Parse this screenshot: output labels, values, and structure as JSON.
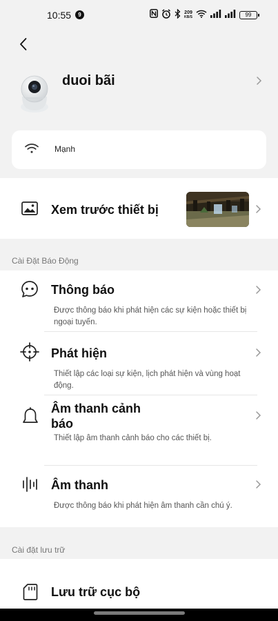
{
  "status_bar": {
    "time": "10:55",
    "notification_count": "9",
    "net_speed_value": "209",
    "net_speed_unit": "KB/S",
    "battery": "99"
  },
  "device": {
    "name": "duoi bãi"
  },
  "signal": {
    "label": "Mạnh"
  },
  "preview": {
    "title": "Xem trước thiết bị"
  },
  "alarm_section": {
    "header": "Cài Đặt Báo Động",
    "items": [
      {
        "title": "Thông báo",
        "desc": "Được thông báo khi phát hiện các sự kiện hoặc thiết bị ngoại tuyến."
      },
      {
        "title": "Phát hiện",
        "desc": "Thiết lập các loại sự kiện, lịch phát hiện và vùng hoạt động."
      },
      {
        "title": "Âm thanh cảnh báo",
        "desc": "Thiết lập âm thanh cảnh báo cho các thiết bị."
      },
      {
        "title": "Âm thanh",
        "desc": "Được thông báo khi phát hiện âm thanh cần chú ý."
      }
    ]
  },
  "storage_section": {
    "header": "Cài đặt lưu trữ",
    "items": [
      {
        "title": "Lưu trữ cục bộ"
      }
    ]
  },
  "colors": {
    "background": "#f2f2f2",
    "card": "#ffffff",
    "muted_text": "#777777"
  }
}
